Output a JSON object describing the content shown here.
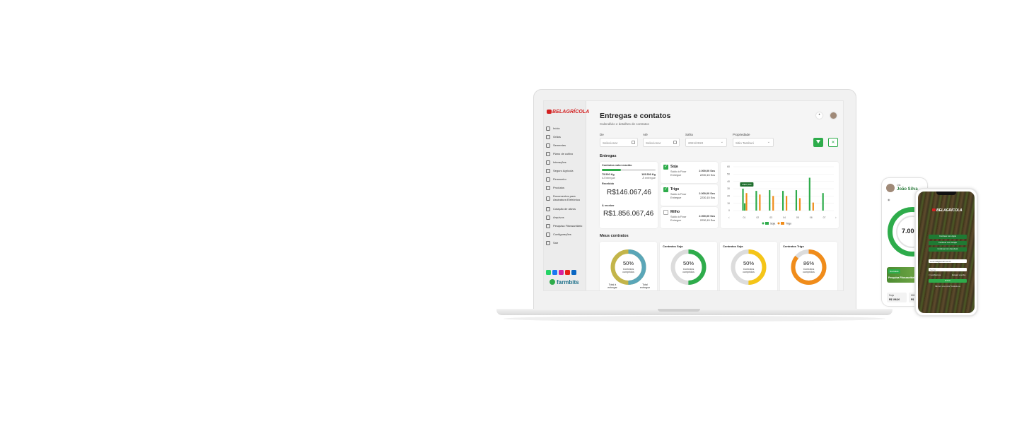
{
  "app": {
    "brand": "BELAGRÍCOLA",
    "title": "Entregas e contatos",
    "subtitle": "Calendário e detalhes de contratos",
    "footer_brand": "farmbits"
  },
  "sidebar": {
    "items": [
      {
        "label": "Início",
        "icon": "home-icon"
      },
      {
        "label": "Grãos",
        "icon": "grain-icon"
      },
      {
        "label": "Sementes",
        "icon": "seed-icon"
      },
      {
        "label": "Plano de cultivo",
        "icon": "plant-icon"
      },
      {
        "label": "Interações",
        "icon": "chat-icon"
      },
      {
        "label": "Seguro Agrícola",
        "icon": "shield-icon"
      },
      {
        "label": "Financeiro",
        "icon": "money-icon"
      },
      {
        "label": "Produtos",
        "icon": "box-icon"
      },
      {
        "label": "Documentos para Assinatura Eletrônica",
        "icon": "document-icon"
      },
      {
        "label": "Cotação de ativos",
        "icon": "chart-icon"
      },
      {
        "label": "Arquivos",
        "icon": "file-icon"
      },
      {
        "label": "Pesquisa Fitossanitário",
        "icon": "search-icon"
      },
      {
        "label": "Configurações",
        "icon": "gear-icon"
      },
      {
        "label": "Sair",
        "icon": "logout-icon"
      }
    ],
    "socials": [
      {
        "icon": "whatsapp-icon",
        "color": "#25d366"
      },
      {
        "icon": "facebook-icon",
        "color": "#1877f2"
      },
      {
        "icon": "instagram-icon",
        "color": "#d6249f"
      },
      {
        "icon": "youtube-icon",
        "color": "#e62117"
      },
      {
        "icon": "linkedin-icon",
        "color": "#0a66c2"
      }
    ]
  },
  "filters": {
    "de_label": "De",
    "de_placeholder": "Selecionar",
    "ate_label": "Até",
    "ate_placeholder": "Selecionar",
    "safra_label": "Safra",
    "safra_value": "2021/2022",
    "prop_label": "Propriedade",
    "prop_value": "Sitio Tamburi"
  },
  "entregas": {
    "section": "Entregas",
    "contracts_label": "Contratos valor maxido",
    "progress": 0.35,
    "delivered_qty": "75.500 Kg",
    "delivered_label": "A Entregue",
    "pending_qty": "105.500 Kg",
    "pending_label": "À entregue",
    "recebido_label": "Recebido",
    "recebido_value": "R$146.067,46",
    "receber_label": "À receber",
    "receber_value": "R$1.856.067,46",
    "crops": [
      {
        "name": "Soja",
        "checked": true,
        "l1": "Saldo à Fixar",
        "l2": "Entregue",
        "v1": "2.000,00 Scs",
        "v2": "2230,15 Scs"
      },
      {
        "name": "Trigo",
        "checked": true,
        "l1": "Saldo à Fixar",
        "l2": "Entregue",
        "v1": "2.000,00 Scs",
        "v2": "2230,15 Scs"
      },
      {
        "name": "Milho",
        "checked": false,
        "l1": "Saldo à Fixar",
        "l2": "Entregue",
        "v1": "2.000,00 Scs",
        "v2": "2230,15 Scs"
      }
    ]
  },
  "chart_data": {
    "type": "bar",
    "categories": [
      "01",
      "02",
      "03",
      "04",
      "05",
      "06",
      "07"
    ],
    "series": [
      {
        "name": "Soja",
        "color": "#2eac4b",
        "values": [
          [
            30,
            10
          ],
          [
            27
          ],
          [
            28
          ],
          [
            27
          ],
          [
            28
          ],
          [
            45
          ],
          [
            24
          ]
        ]
      },
      {
        "name": "Trigo",
        "color": "#f08c1a",
        "values": [
          [
            24
          ],
          [
            22
          ],
          [
            20
          ],
          [
            20
          ],
          [
            17
          ],
          [
            11
          ],
          [
            0
          ]
        ]
      }
    ],
    "ylim": [
      0,
      60
    ],
    "yticks": [
      "60",
      "50",
      "40",
      "30",
      "20",
      "10",
      "0"
    ],
    "tooltip": "R$27,000",
    "legend": [
      "Soja",
      "Trigo"
    ]
  },
  "contratos": {
    "section": "Meus contratos",
    "cards": [
      {
        "title": "",
        "pct": "50%",
        "label": "Contratos cumpridos",
        "color": "#5aa6b8",
        "color2": "#c3b54a",
        "value": 0.5,
        "footer_left": "Total à entregar",
        "footer_right": "Total entregue"
      },
      {
        "title": "Contratos Soja",
        "pct": "50%",
        "label": "Contratos cumpridos",
        "color": "#2eac4b",
        "value": 0.5
      },
      {
        "title": "Contratos Soja",
        "pct": "50%",
        "label": "Contratos cumpridos",
        "color": "#f5c518",
        "value": 0.5
      },
      {
        "title": "Contratos Trigo",
        "pct": "86%",
        "label": "Contratos cumpridos",
        "color": "#f08c1a",
        "value": 0.86
      }
    ]
  },
  "phone1": {
    "greeting": "Olá",
    "name": "João Silva",
    "figure": "7.000",
    "banner": "Pesquisa Fitossanitário",
    "mini_cards": [
      {
        "label": "Soja",
        "value": "R$ 196,00"
      },
      {
        "label": "Milho",
        "value": "R$ 99,"
      }
    ]
  },
  "phone2": {
    "brand": "BELAGRÍCOLA",
    "buttons": [
      "Continuar com Apple",
      "Continuar com Google",
      "Continuar com Facebook"
    ],
    "email_value": "seuemail@email.com.br",
    "password_placeholder": "Senha",
    "remember_label": "Lembrar-me",
    "forgot_label": "Esqueci a senha",
    "submit_label": "Entrar",
    "signup_label": "Não tem uma conta? Cadastre-se"
  }
}
